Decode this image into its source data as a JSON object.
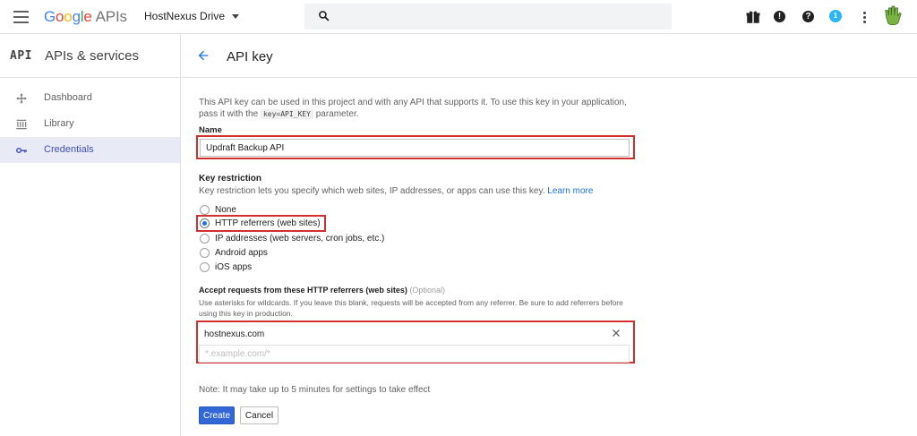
{
  "topbar": {
    "logo_g": [
      "G",
      "o",
      "o",
      "g",
      "l",
      "e"
    ],
    "logo_apis": "APIs",
    "project": "HostNexus Drive",
    "badge_count": "1"
  },
  "sidebar": {
    "api_mark": "API",
    "title": "APIs & services",
    "items": [
      {
        "label": "Dashboard",
        "icon": "dashboard-icon"
      },
      {
        "label": "Library",
        "icon": "library-icon"
      },
      {
        "label": "Credentials",
        "icon": "key-icon",
        "active": true
      }
    ]
  },
  "main": {
    "title": "API key",
    "desc_part1": "This API key can be used in this project and with any API that supports it. To use this key in your application, pass it with the",
    "desc_code": "key=API_KEY",
    "desc_part2": "parameter.",
    "name_label": "Name",
    "name_value": "Updraft Backup API",
    "restriction_title": "Key restriction",
    "restriction_desc": "Key restriction lets you specify which web sites, IP addresses, or apps can use this key.",
    "learn_more": "Learn more",
    "options": [
      "None",
      "HTTP referrers (web sites)",
      "IP addresses (web servers, cron jobs, etc.)",
      "Android apps",
      "iOS apps"
    ],
    "selected_option": "HTTP referrers (web sites)",
    "referrers_title": "Accept requests from these HTTP referrers (web sites)",
    "referrers_optional": "(Optional)",
    "referrers_desc": "Use asterisks for wildcards. If you leave this blank, requests will be accepted from any referrer. Be sure to add referrers before using this key in production.",
    "referrer_entry": "hostnexus.com",
    "referrer_placeholder": "*.example.com/*",
    "note": "Note: It may take up to 5 minutes for settings to take effect",
    "create_label": "Create",
    "cancel_label": "Cancel"
  },
  "colors": {
    "accent": "#3367d6",
    "highlight": "#d32f2f",
    "active_bg": "#e8eaf6",
    "active_text": "#3f51b5"
  }
}
